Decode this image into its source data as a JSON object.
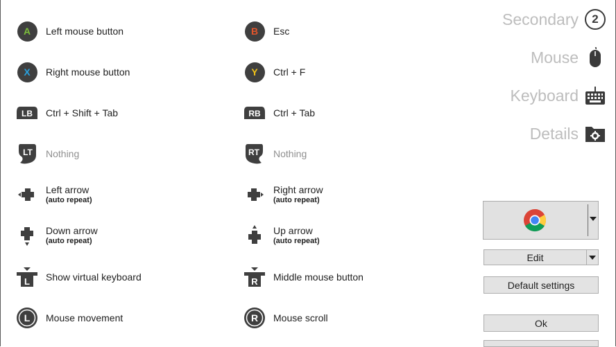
{
  "mappings": {
    "a": {
      "glyph": "A",
      "glyph_color": "#7cbe3c",
      "label": "Left mouse button"
    },
    "b": {
      "glyph": "B",
      "glyph_color": "#e3552b",
      "label": "Esc"
    },
    "x": {
      "glyph": "X",
      "glyph_color": "#2aa1de",
      "label": "Right mouse button"
    },
    "y": {
      "glyph": "Y",
      "glyph_color": "#f2c318",
      "label": "Ctrl + F"
    },
    "lb": {
      "glyph": "LB",
      "label": "Ctrl + Shift + Tab"
    },
    "rb": {
      "glyph": "RB",
      "label": "Ctrl + Tab"
    },
    "lt": {
      "glyph": "LT",
      "label": "Nothing"
    },
    "rt": {
      "glyph": "RT",
      "label": "Nothing"
    },
    "dpad_left": {
      "label": "Left arrow",
      "sub": "(auto repeat)"
    },
    "dpad_right": {
      "label": "Right arrow",
      "sub": "(auto repeat)"
    },
    "dpad_down": {
      "label": "Down arrow",
      "sub": "(auto repeat)"
    },
    "dpad_up": {
      "label": "Up arrow",
      "sub": "(auto repeat)"
    },
    "ls_click": {
      "glyph": "L",
      "label": "Show virtual keyboard"
    },
    "rs_click": {
      "glyph": "R",
      "label": "Middle mouse button"
    },
    "ls": {
      "glyph": "L",
      "label": "Mouse movement"
    },
    "rs": {
      "glyph": "R",
      "label": "Mouse scroll"
    }
  },
  "nav": {
    "secondary": {
      "label": "Secondary",
      "badge": "2"
    },
    "mouse": {
      "label": "Mouse",
      "icon": "mouse-icon"
    },
    "keyboard": {
      "label": "Keyboard",
      "icon": "keyboard-icon"
    },
    "details": {
      "label": "Details",
      "icon": "folder-gear-icon"
    }
  },
  "side": {
    "app_icon": "chrome-icon",
    "edit_label": "Edit",
    "default_label": "Default settings",
    "ok_label": "Ok"
  },
  "colors": {
    "glyph_bg": "#3f3f3f",
    "nav_text": "#bdbdbd",
    "muted_text": "#8f8f8f"
  }
}
